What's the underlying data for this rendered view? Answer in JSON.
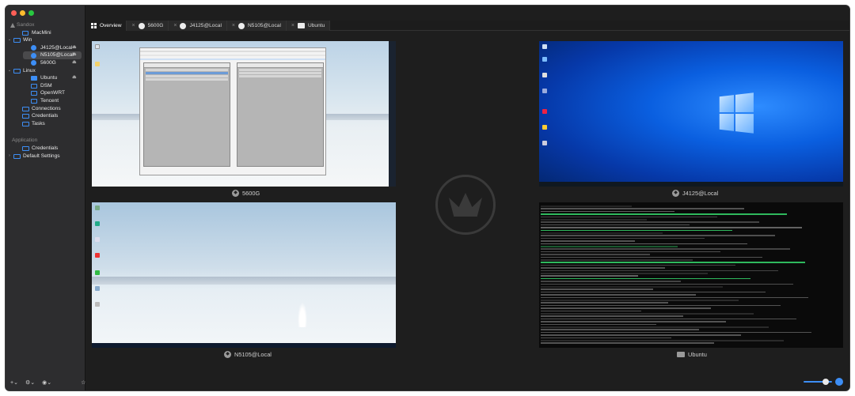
{
  "sidebar": {
    "root": {
      "label": "Sandox"
    },
    "items": [
      {
        "label": "MacMini",
        "kind": "sqo",
        "indent": 1
      },
      {
        "label": "Win",
        "kind": "folder",
        "indent": 0,
        "chev": "v"
      },
      {
        "label": "J4125@Local",
        "kind": "badge",
        "indent": 2,
        "up": true
      },
      {
        "label": "N5105@Local",
        "kind": "badge",
        "indent": 2,
        "up": true,
        "selected": true
      },
      {
        "label": "5600G",
        "kind": "badge",
        "indent": 2,
        "up": true
      },
      {
        "label": "Linux",
        "kind": "folder",
        "indent": 0,
        "chev": "v"
      },
      {
        "label": "Ubuntu",
        "kind": "sq",
        "indent": 2,
        "up": true
      },
      {
        "label": "DSM",
        "kind": "sqo",
        "indent": 2
      },
      {
        "label": "OpenWRT",
        "kind": "sqo",
        "indent": 2
      },
      {
        "label": "Tencent",
        "kind": "sqo",
        "indent": 2
      },
      {
        "label": "Connections",
        "kind": "folder",
        "indent": 1
      },
      {
        "label": "Credentials",
        "kind": "folder",
        "indent": 1
      },
      {
        "label": "Tasks",
        "kind": "folder",
        "indent": 1
      }
    ],
    "section_application": "Application",
    "app_items": [
      {
        "label": "Credentials",
        "kind": "folder",
        "indent": 1
      },
      {
        "label": "Default Settings",
        "kind": "folder",
        "indent": 0,
        "chev": ">"
      }
    ],
    "bottom": {
      "add": "+⌄",
      "gear": "⚙⌄",
      "settings2": "◉⌄",
      "star": "☆",
      "play": "▷"
    }
  },
  "tabs": [
    {
      "label": "Overview",
      "active": true
    },
    {
      "label": "5600G"
    },
    {
      "label": "J4125@Local"
    },
    {
      "label": "N5105@Local"
    },
    {
      "label": "Ubuntu"
    }
  ],
  "tiles": [
    {
      "label": "5600G"
    },
    {
      "label": "J4125@Local"
    },
    {
      "label": "N5105@Local"
    },
    {
      "label": "Ubuntu"
    }
  ],
  "colors": {
    "accent": "#3d8ef5",
    "bg": "#1e1e1e",
    "sidebar": "#2d2d2f"
  }
}
